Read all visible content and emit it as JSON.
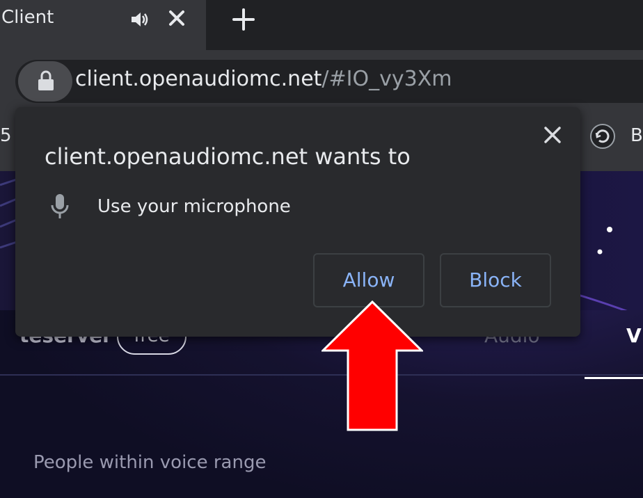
{
  "tab": {
    "title": "Client",
    "audio_icon": "speaker-icon",
    "close_icon": "close-icon",
    "new_tab_icon": "plus-icon"
  },
  "omnibox": {
    "lock_icon": "lock-icon",
    "url_host": "client.openaudiomc.net",
    "url_path": "/#IO_vy3Xm"
  },
  "bookmarks": {
    "left_text": "5",
    "right_icon": "extension-icon",
    "right_text": "B"
  },
  "dialog": {
    "title": "client.openaudiomc.net wants to",
    "permission_icon": "microphone-icon",
    "permission_text": "Use your microphone",
    "allow_label": "Allow",
    "block_label": "Block",
    "close_icon": "close-icon"
  },
  "page": {
    "server_name": "teserver",
    "badge": "free",
    "tab_audio": "Audio",
    "tab_voice": "V",
    "people_label": "People within voice range"
  },
  "annotation": {
    "arrow_icon": "red-arrow-up-icon",
    "arrow_color": "#ff0000"
  },
  "colors": {
    "accent_blue": "#8ab4f8",
    "chrome_dark": "#202124",
    "chrome_toolbar": "#35363a",
    "dialog_bg": "#292a2d"
  }
}
